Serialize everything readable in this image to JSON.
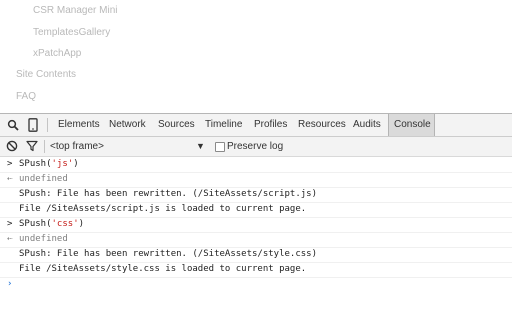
{
  "nav": {
    "items": [
      {
        "label": "CSR Manager Mini"
      },
      {
        "label": "TemplatesGallery"
      },
      {
        "label": "xPatchApp"
      },
      {
        "label": "Site Contents"
      },
      {
        "label": "FAQ"
      }
    ]
  },
  "devtools": {
    "tabs": [
      "Elements",
      "Network",
      "Sources",
      "Timeline",
      "Profiles",
      "Resources",
      "Audits",
      "Console"
    ],
    "active_tab": "Console",
    "frame_select": "<top frame>",
    "preserve_log_label": "Preserve log",
    "preserve_log_checked": false
  },
  "console": {
    "lines": [
      {
        "type": "input",
        "prefix": "SPush(",
        "arg": "'js'",
        "suffix": ")"
      },
      {
        "type": "result",
        "text": "undefined"
      },
      {
        "type": "log",
        "text": "SPush: File has been rewritten. (/SiteAssets/script.js)"
      },
      {
        "type": "log",
        "text": "File /SiteAssets/script.js is loaded to current page."
      },
      {
        "type": "input",
        "prefix": "SPush(",
        "arg": "'css'",
        "suffix": ")"
      },
      {
        "type": "result",
        "text": "undefined"
      },
      {
        "type": "log",
        "text": "SPush: File has been rewritten. (/SiteAssets/style.css)"
      },
      {
        "type": "log",
        "text": "File /SiteAssets/style.css is loaded to current page."
      },
      {
        "type": "prompt",
        "text": ""
      }
    ]
  },
  "colors": {
    "string": "#c41a16",
    "prompt": "#2f7bd8",
    "muted": "#808080"
  }
}
